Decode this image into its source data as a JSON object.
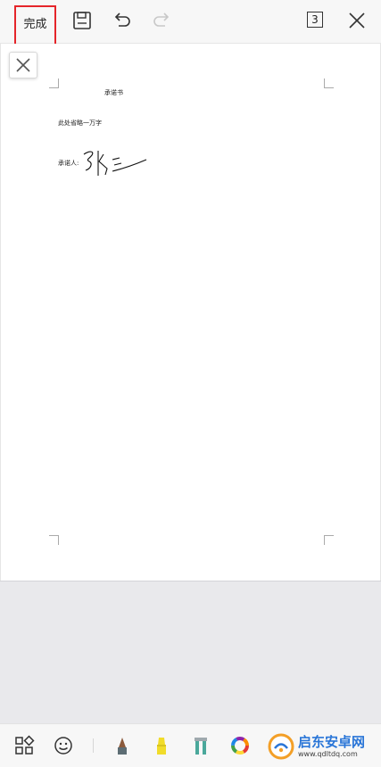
{
  "toolbar": {
    "done_label": "完成",
    "page_count": "3",
    "icons": [
      "save-icon",
      "undo-icon",
      "redo-icon",
      "close-icon"
    ]
  },
  "document": {
    "title": "承诺书",
    "body": "此处省略一万字",
    "signer_label": "承诺人:"
  },
  "bottom_tools": {
    "icons": [
      "grid-icon",
      "emoji-icon",
      "pen-icon",
      "highlighter-icon",
      "marker-icon",
      "color-wheel-icon"
    ],
    "colors": {
      "pen": "#8b5a3c",
      "highlighter": "#f1dc2a",
      "marker": "#4aa89b"
    }
  },
  "watermark": {
    "main": "启东安卓网",
    "sub": "www.qdltdq.com"
  },
  "colors": {
    "highlight_border": "#e5252a",
    "watermark_blue": "#1f6fd6",
    "watermark_orange": "#f39b1c"
  }
}
